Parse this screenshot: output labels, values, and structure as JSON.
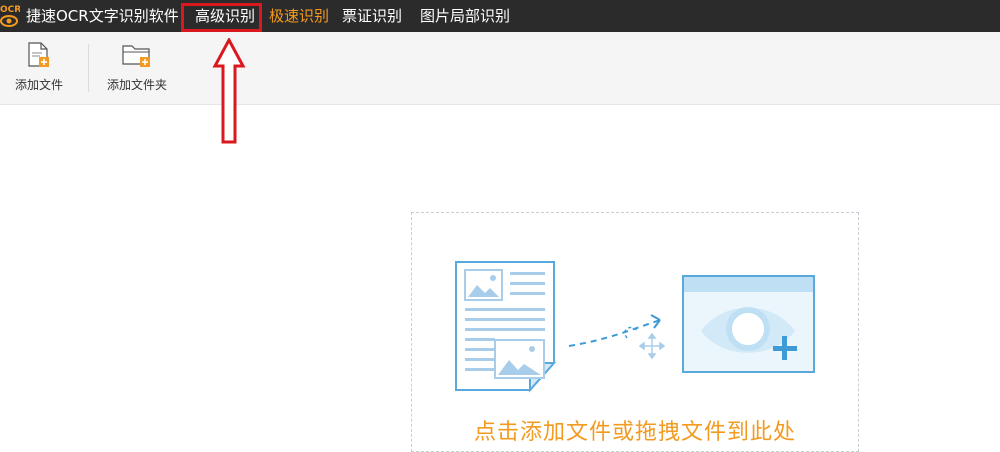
{
  "app": {
    "logo_text": "OCR",
    "title": "捷速OCR文字识别软件"
  },
  "nav": {
    "tabs": [
      {
        "label": "高级识别",
        "active": false,
        "highlighted": true
      },
      {
        "label": "极速识别",
        "active": true
      },
      {
        "label": "票证识别",
        "active": false
      },
      {
        "label": "图片局部识别",
        "active": false
      }
    ]
  },
  "toolbar": {
    "add_file_label": "添加文件",
    "add_folder_label": "添加文件夹"
  },
  "drop_zone": {
    "hint": "点击添加文件或拖拽文件到此处"
  },
  "colors": {
    "topbar_bg": "#2b2b2b",
    "accent": "#f39a21",
    "annotation_red": "#d9181f",
    "illustration_blue": "#5aa9dc"
  }
}
